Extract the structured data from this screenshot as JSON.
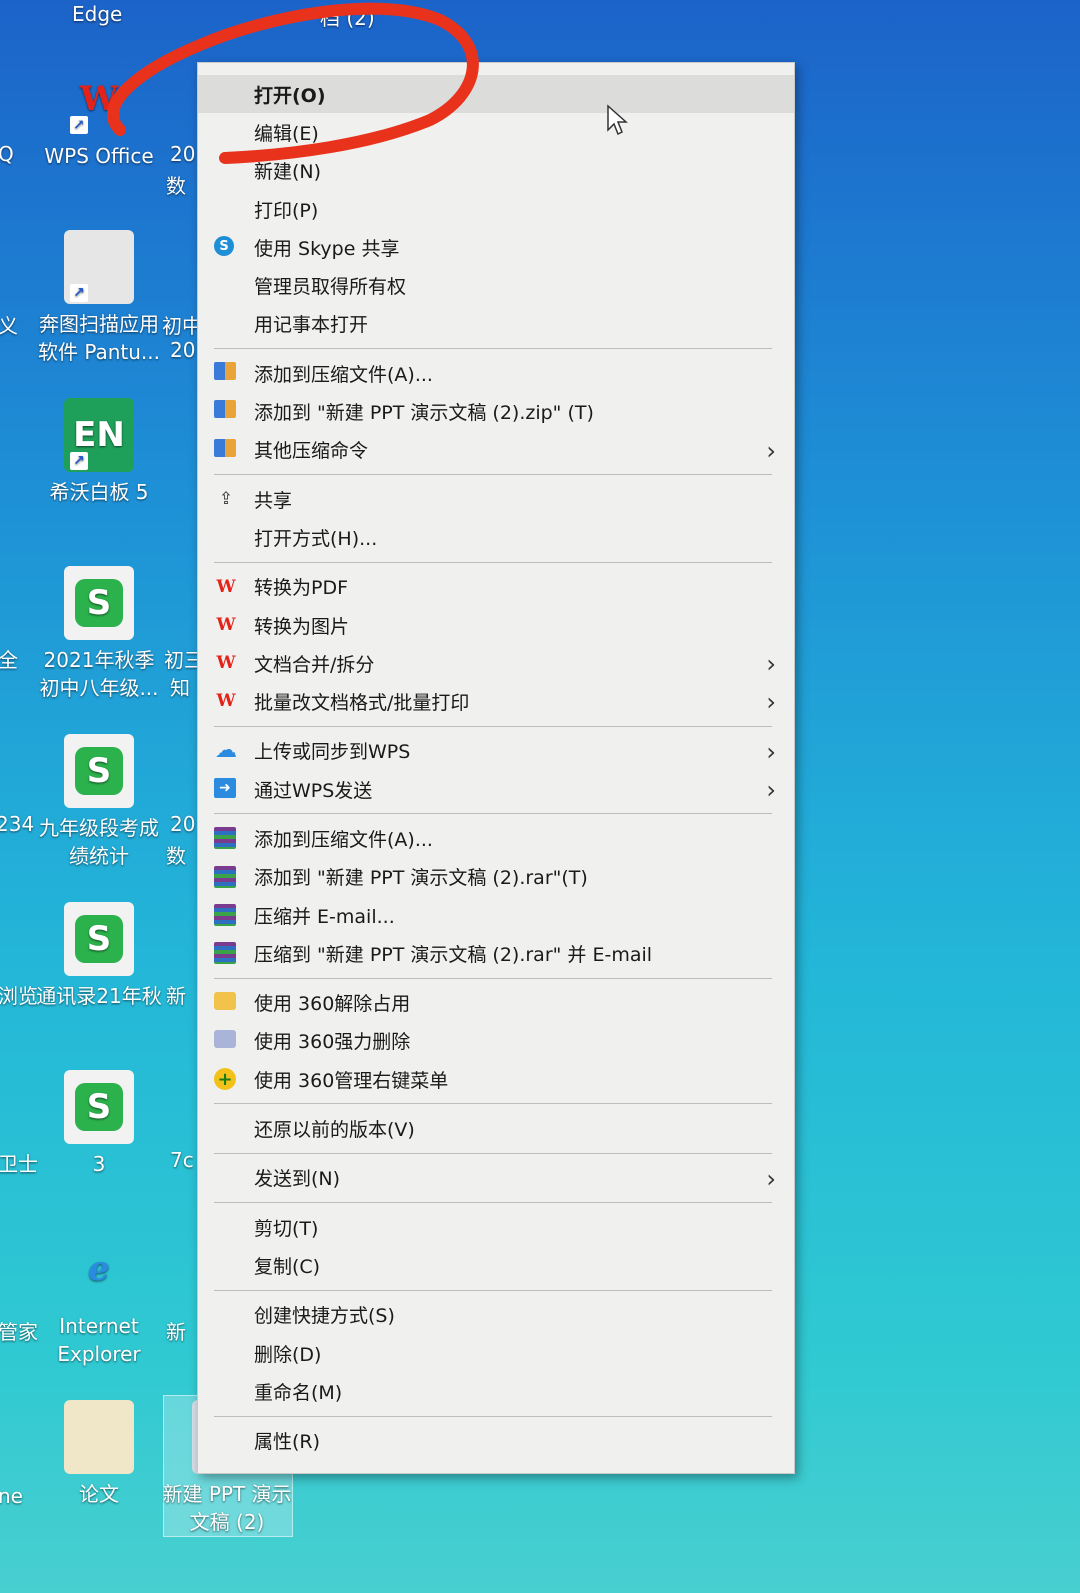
{
  "desktop": {
    "top_fragments": [
      "Edge",
      "档 (2)"
    ],
    "icons": [
      {
        "label": "WPS Office",
        "glyph": "W"
      },
      {
        "label": "奔图扫描应用软件 Pantu...",
        "glyph": ""
      },
      {
        "label": "希沃白板 5",
        "glyph": "EN"
      },
      {
        "label": "2021年秋季初中八年级...",
        "glyph": "S"
      },
      {
        "label": "九年级段考成绩统计",
        "glyph": "S"
      },
      {
        "label": "通讯录21年秋",
        "glyph": "S"
      },
      {
        "label": "3",
        "glyph": "S"
      },
      {
        "label": "Internet Explorer",
        "glyph": "e"
      },
      {
        "label": "论文",
        "glyph": ""
      },
      {
        "label": "新建 PPT 演示文稿 (2)",
        "glyph": ""
      }
    ],
    "edge_fragments": [
      "Q",
      "20",
      "数",
      "义",
      "初中",
      "20",
      "全",
      "初三",
      "知",
      "234",
      "20",
      "数",
      "浏览",
      "新",
      "卫士",
      "7c",
      "管家",
      "新",
      "ne"
    ]
  },
  "menu": {
    "group1": [
      {
        "label": "打开(O)",
        "icon": ""
      },
      {
        "label": "编辑(E)",
        "icon": ""
      },
      {
        "label": "新建(N)",
        "icon": ""
      },
      {
        "label": "打印(P)",
        "icon": ""
      },
      {
        "label": "使用 Skype 共享",
        "icon": "skype-icon",
        "glyph": "S"
      },
      {
        "label": "管理员取得所有权",
        "icon": ""
      },
      {
        "label": "用记事本打开",
        "icon": ""
      }
    ],
    "group2": [
      {
        "label": "添加到压缩文件(A)...",
        "icon": "archive-icon"
      },
      {
        "label": "添加到 \"新建 PPT 演示文稿 (2).zip\" (T)",
        "icon": "archive-icon"
      },
      {
        "label": "其他压缩命令",
        "icon": "archive-icon",
        "submenu": true
      }
    ],
    "group3": [
      {
        "label": "共享",
        "icon": "share-icon",
        "glyph": "⇪"
      },
      {
        "label": "打开方式(H)...",
        "icon": ""
      }
    ],
    "group4": [
      {
        "label": "转换为PDF",
        "icon": "wps-icon",
        "glyph": "W"
      },
      {
        "label": "转换为图片",
        "icon": "wps-icon",
        "glyph": "W"
      },
      {
        "label": "文档合并/拆分",
        "icon": "wps-icon",
        "glyph": "W",
        "submenu": true
      },
      {
        "label": "批量改文档格式/批量打印",
        "icon": "wps-icon",
        "glyph": "W",
        "submenu": true
      }
    ],
    "group5": [
      {
        "label": "上传或同步到WPS",
        "icon": "cloud-upload-icon",
        "glyph": "☁",
        "submenu": true
      },
      {
        "label": "通过WPS发送",
        "icon": "send-icon",
        "glyph": "➜",
        "submenu": true
      }
    ],
    "group6": [
      {
        "label": "添加到压缩文件(A)...",
        "icon": "winrar-icon"
      },
      {
        "label": "添加到 \"新建 PPT 演示文稿 (2).rar\"(T)",
        "icon": "winrar-icon"
      },
      {
        "label": "压缩并 E-mail...",
        "icon": "winrar-icon"
      },
      {
        "label": "压缩到 \"新建 PPT 演示文稿 (2).rar\" 并 E-mail",
        "icon": "winrar-icon"
      }
    ],
    "group7": [
      {
        "label": "使用 360解除占用",
        "icon": "360-unlock-icon"
      },
      {
        "label": "使用 360强力删除",
        "icon": "360-shred-icon"
      },
      {
        "label": "使用 360管理右键菜单",
        "icon": "360-menu-icon",
        "glyph": "+"
      }
    ],
    "group8": [
      {
        "label": "还原以前的版本(V)",
        "icon": ""
      }
    ],
    "group9": [
      {
        "label": "发送到(N)",
        "icon": "",
        "submenu": true
      }
    ],
    "group10": [
      {
        "label": "剪切(T)",
        "icon": ""
      },
      {
        "label": "复制(C)",
        "icon": ""
      }
    ],
    "group11": [
      {
        "label": "创建快捷方式(S)",
        "icon": ""
      },
      {
        "label": "删除(D)",
        "icon": ""
      },
      {
        "label": "重命名(M)",
        "icon": ""
      }
    ],
    "group12": [
      {
        "label": "属性(R)",
        "icon": ""
      }
    ],
    "submenu_arrow": "›"
  },
  "colors": {
    "annotation": "#e8321c",
    "menu_bg": "#f0f0ee",
    "hover_bg": "#dcdcda"
  }
}
